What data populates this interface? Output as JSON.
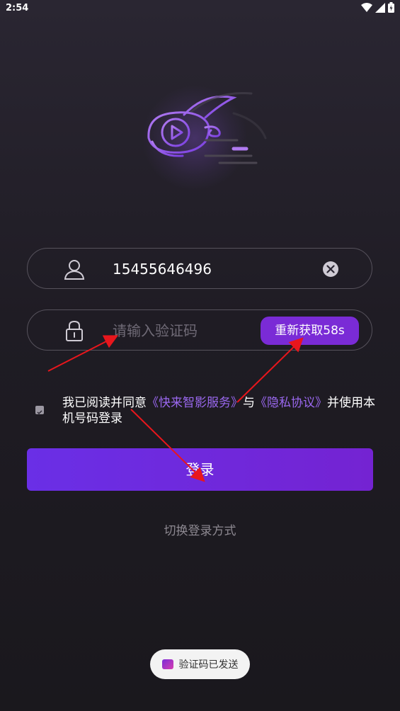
{
  "status_bar": {
    "time": "2:54",
    "icons": [
      "wifi-icon",
      "signal-icon",
      "battery-icon"
    ]
  },
  "logo": {
    "icon": "rabbit-play-logo"
  },
  "phone_field": {
    "value": "15455646496",
    "icon": "user-icon",
    "clear_icon": "clear-icon"
  },
  "code_field": {
    "placeholder": "请输入验证码",
    "icon": "lock-icon",
    "resend_label": "重新获取58s"
  },
  "agreement": {
    "checked": true,
    "prefix": "我已阅读并同意",
    "service_link": "《快来智影服务》",
    "connector": "与",
    "privacy_link": "《隐私协议》",
    "suffix": "并使用本机号码登录"
  },
  "login_button": {
    "label": "登录"
  },
  "switch_login": {
    "label": "切换登录方式"
  },
  "toast": {
    "message": "验证码已发送"
  },
  "colors": {
    "accent": "#7a2bd6",
    "link": "#9b68f0",
    "annotation_arrow": "#e8161c"
  }
}
